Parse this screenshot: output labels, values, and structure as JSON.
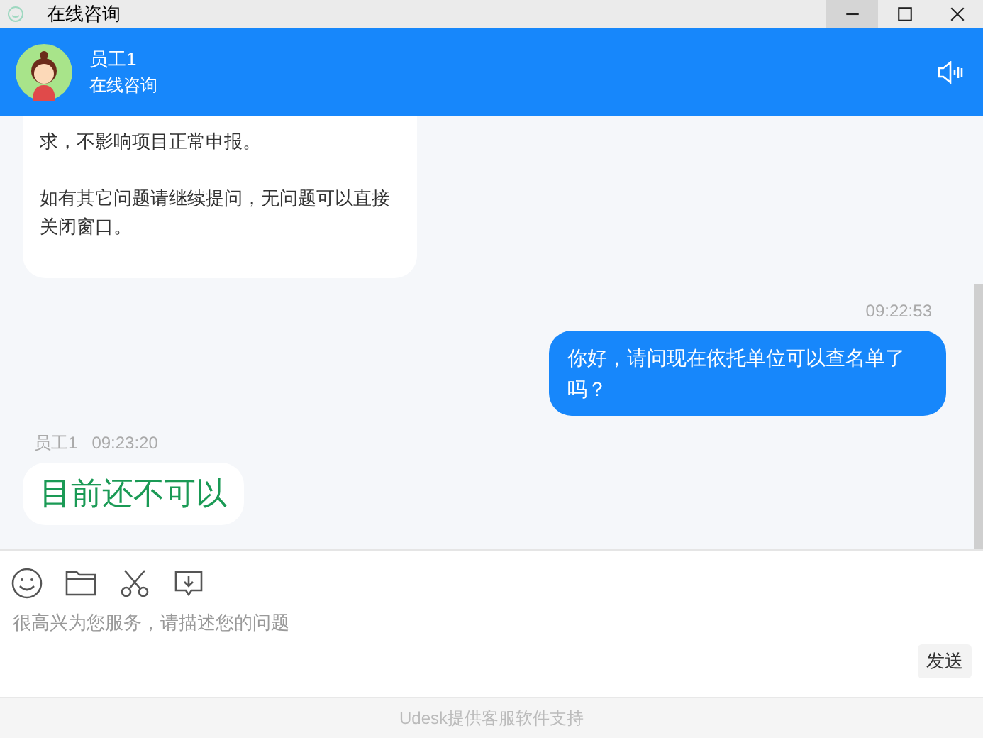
{
  "window": {
    "title": "在线咨询",
    "controls": [
      {
        "kind": "minimize",
        "hovered": true
      },
      {
        "kind": "maximize",
        "hovered": false
      },
      {
        "kind": "close",
        "hovered": false
      }
    ]
  },
  "header": {
    "name": "员工1",
    "subtitle": "在线咨询"
  },
  "messages": [
    {
      "kind": "agent",
      "paragraphs": [
        "求，不影响项目正常申报。",
        "如有其它问题请继续提问，无问题可以直接关闭窗口。"
      ],
      "emphasis": false
    },
    {
      "kind": "customer",
      "time": "09:22:53",
      "paragraphs": [
        "你好，请问现在依托单位可以查名单了吗？"
      ],
      "emphasis": false
    },
    {
      "kind": "agent",
      "sender": "员工1",
      "time": "09:23:20",
      "paragraphs": [
        "目前还不可以"
      ],
      "emphasis": true
    }
  ],
  "input": {
    "placeholder": "很高兴为您服务，请描述您的问题",
    "send_label": "发送"
  },
  "footer": "Udesk提供客服软件支持"
}
